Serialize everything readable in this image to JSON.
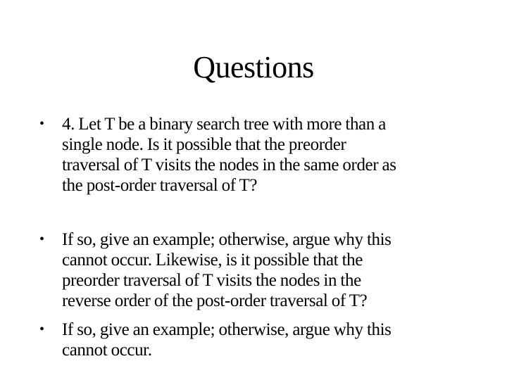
{
  "slide": {
    "title": "Questions",
    "bullets": [
      {
        "marker": "•",
        "lines": [
          "4.  Let T be a binary search tree with more than a",
          "single node. Is it possible that the preorder",
          "traversal of T visits the nodes in the same order as",
          "the post-order traversal of T?"
        ]
      },
      {
        "marker": "•",
        "lines": [
          "If so, give an example; otherwise, argue why this",
          "cannot occur. Likewise, is it possible that the",
          "preorder traversal of T visits the nodes in the",
          "reverse order of the post-order traversal of T?"
        ]
      },
      {
        "marker": "•",
        "lines": [
          "If so, give an example; otherwise, argue why this",
          "cannot occur."
        ]
      }
    ]
  }
}
